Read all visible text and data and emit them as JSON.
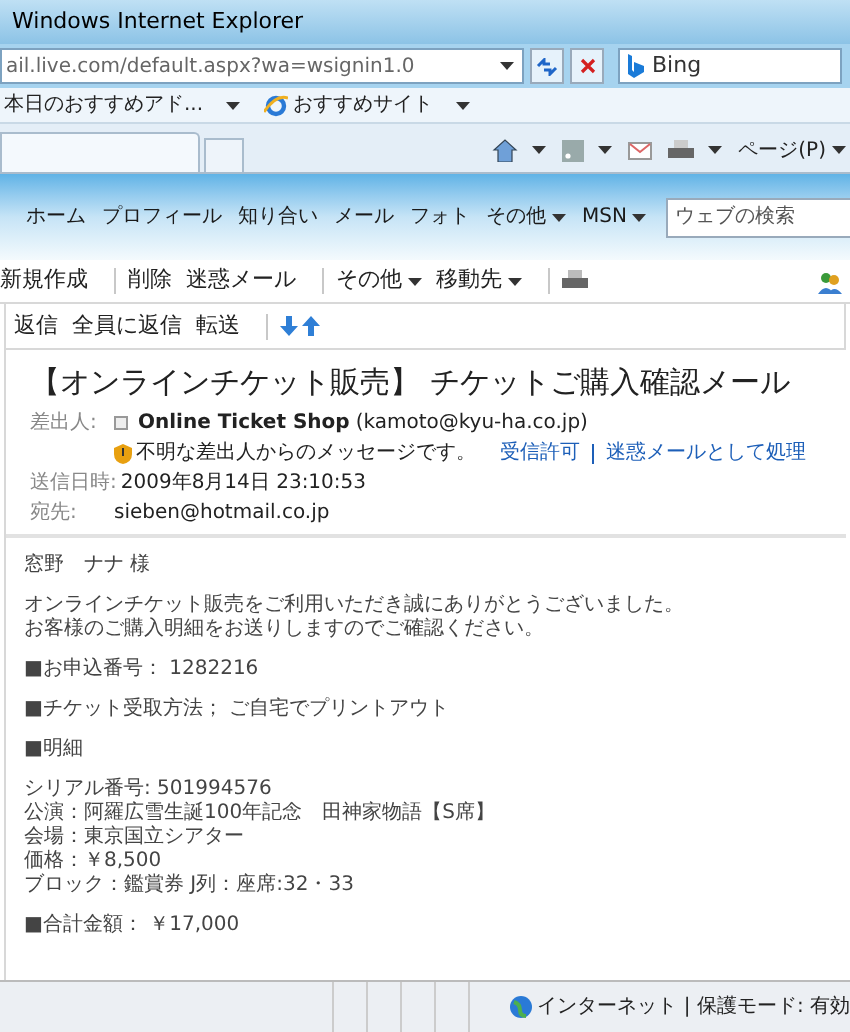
{
  "window": {
    "title": "Windows Internet Explorer"
  },
  "address_bar": {
    "url": "ail.live.com/default.aspx?wa=wsignin1.0",
    "search_provider": "Bing"
  },
  "favorites_bar": {
    "items": [
      "本日のおすすめアド...",
      "おすすめサイト"
    ]
  },
  "command_bar": {
    "page_menu": "ページ(P)"
  },
  "site_nav": {
    "items": [
      {
        "label": "ホーム",
        "dropdown": false
      },
      {
        "label": "プロフィール",
        "dropdown": false
      },
      {
        "label": "知り合い",
        "dropdown": false
      },
      {
        "label": "メール",
        "dropdown": false
      },
      {
        "label": "フォト",
        "dropdown": false
      },
      {
        "label": "その他",
        "dropdown": true
      },
      {
        "label": "MSN",
        "dropdown": true
      }
    ],
    "search_placeholder": "ウェブの検索"
  },
  "mail_toolbar": {
    "groups": [
      [
        {
          "label": "新規作成",
          "dropdown": false
        }
      ],
      [
        {
          "label": "削除",
          "dropdown": false
        },
        {
          "label": "迷惑メール",
          "dropdown": false
        }
      ],
      [
        {
          "label": "その他",
          "dropdown": true
        },
        {
          "label": "移動先",
          "dropdown": true
        }
      ]
    ]
  },
  "reply_toolbar": {
    "items": [
      "返信",
      "全員に返信",
      "転送"
    ]
  },
  "message": {
    "subject": "【オンラインチケット販売】 チケットご購入確認メール",
    "from_label": "差出人:",
    "sender_name": "Online Ticket Shop",
    "sender_address": "(kamoto@kyu-ha.co.jp)",
    "warning": "不明な差出人からのメッセージです。",
    "warning_links": [
      "受信許可",
      "迷惑メールとして処理"
    ],
    "sent_label": "送信日時:",
    "sent": "2009年8月14日 23:10:53",
    "to_label": "宛先:",
    "to": "sieben@hotmail.co.jp",
    "body": [
      [
        "窓野　ナナ 様"
      ],
      [
        "オンラインチケット販売をご利用いただき誠にありがとうございました。",
        "お客様のご購入明細をお送りしますのでご確認ください。"
      ],
      [
        "■お申込番号： 1282216"
      ],
      [
        "■チケット受取方法； ご自宅でプリントアウト"
      ],
      [
        "■明細"
      ],
      [
        "シリアル番号: 501994576",
        "公演：阿羅広雪生誕100年記念　田神家物語【S席】",
        "会場：東京国立シアター",
        "価格：￥8,500",
        "ブロック：鑑賞券 J列：座席:32・33"
      ],
      [
        "■合計金額： ￥17,000"
      ]
    ]
  },
  "status_bar": {
    "zone": "インターネット | 保護モード: 有効"
  }
}
